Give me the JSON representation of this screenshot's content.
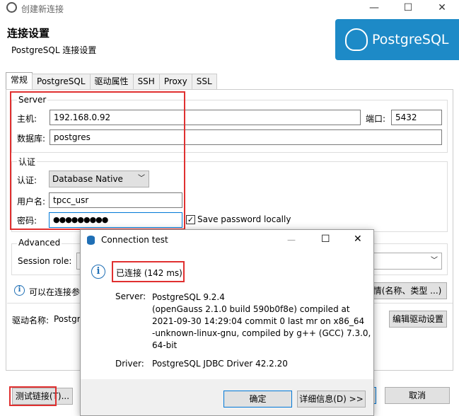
{
  "window": {
    "title": "创建新连接",
    "minimize": "—",
    "maximize": "☐",
    "close": "✕"
  },
  "header": {
    "title": "连接设置",
    "subtitle": "PostgreSQL 连接设置",
    "logo_text": "PostgreSQL"
  },
  "tabs": [
    "常规",
    "PostgreSQL",
    "驱动属性",
    "SSH",
    "Proxy",
    "SSL"
  ],
  "server": {
    "group_label": "Server",
    "host_label": "主机:",
    "host_value": "192.168.0.92",
    "port_label": "端口:",
    "port_value": "5432",
    "db_label": "数据库:",
    "db_value": "postgres"
  },
  "auth": {
    "group_label": "认证",
    "auth_label": "认证:",
    "auth_value": "Database Native",
    "user_label": "用户名:",
    "user_value": "tpcc_usr",
    "pwd_label": "密码:",
    "pwd_value": "●●●●●●●●●",
    "save_pwd_label": "Save password locally",
    "save_pwd_checked": "✓"
  },
  "advanced": {
    "group_label": "Advanced",
    "session_role_label": "Session role:"
  },
  "info_line": {
    "text": "可以在连接参",
    "details_button": "情(名称、类型 ...)"
  },
  "driver": {
    "label": "驱动名称:",
    "value": "Postgr",
    "edit_button": "编辑驱动设置"
  },
  "footer": {
    "test_button": "测试链接(T)...",
    "cancel_button": "取消"
  },
  "dialog": {
    "title": "Connection test",
    "max": "☐",
    "close": "✕",
    "status": "已连接 (142 ms)",
    "server_label": "Server:",
    "server_lines": [
      "PostgreSQL 9.2.4",
      "(openGauss 2.1.0 build 590b0f8e) compiled at",
      "2021-09-30 14:29:04 commit 0 last mr   on x86_64",
      "-unknown-linux-gnu, compiled by g++ (GCC) 7.3.0,",
      "64-bit"
    ],
    "driver_label": "Driver:",
    "driver_value": "PostgreSQL JDBC Driver 42.2.20",
    "ok_button": "确定",
    "details_button": "详细信息(D) >>"
  },
  "colors": {
    "accent": "#1d8ac7",
    "highlight": "#e03030",
    "focus": "#0078d7"
  }
}
